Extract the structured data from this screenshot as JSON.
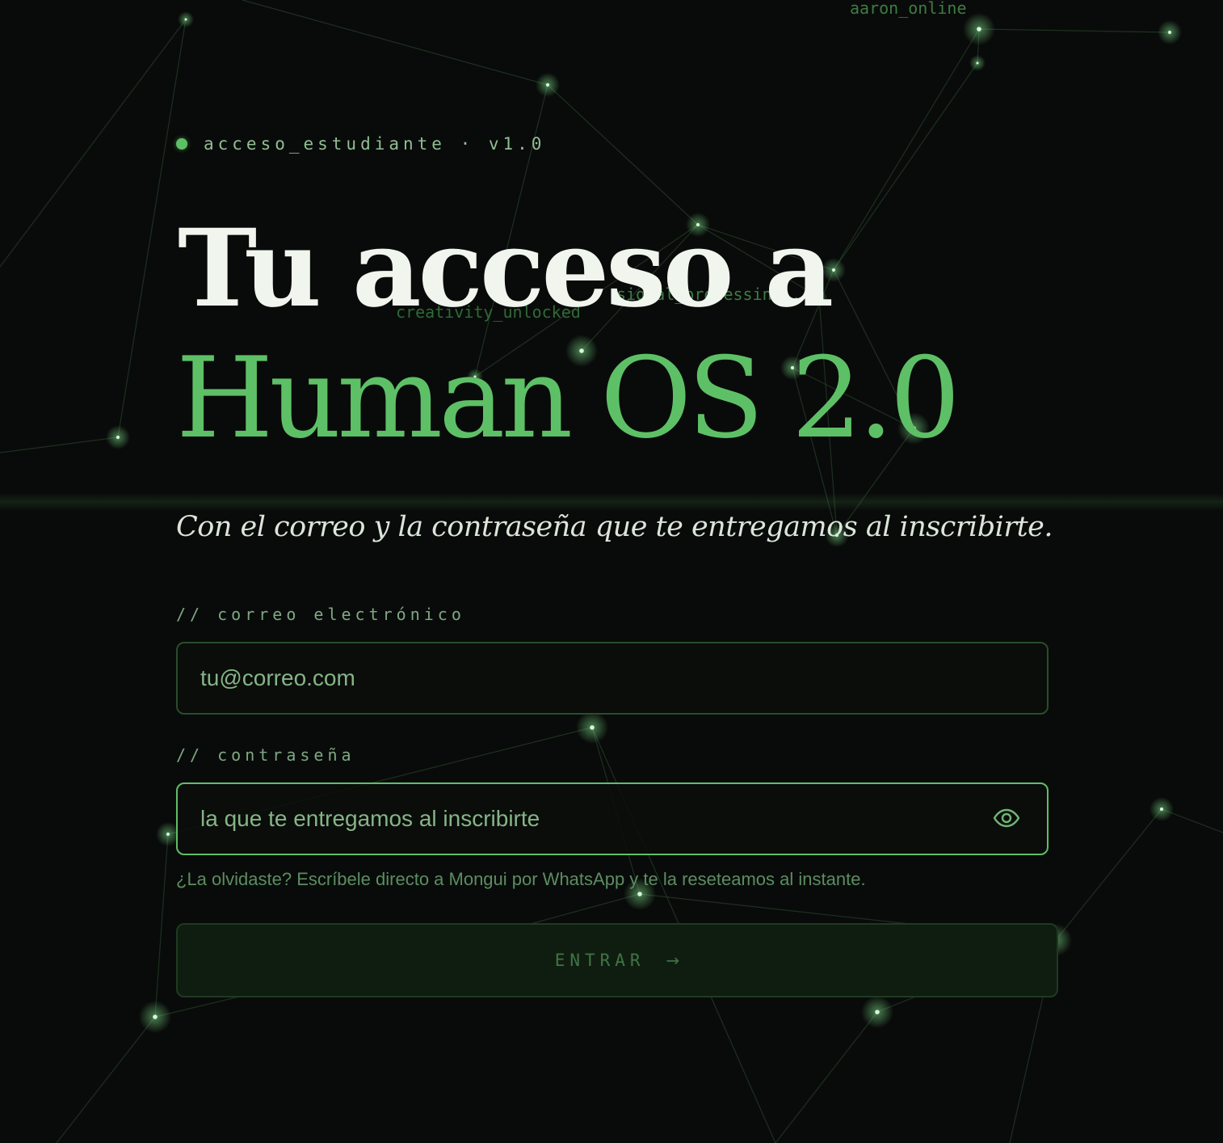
{
  "background": {
    "floating_labels": {
      "aaron": "aaron_online",
      "signal": "signal_processing...",
      "creativity": "creativity_unlocked"
    }
  },
  "header": {
    "eyebrow": "acceso_estudiante · v1.0",
    "title_line1": "Tu acceso a",
    "title_line2": "Human OS 2.0",
    "subtitle": "Con el correo y la contraseña que te entregamos al inscribirte."
  },
  "form": {
    "email_label": "// correo electrónico",
    "email_placeholder": "tu@correo.com",
    "password_label": "// contraseña",
    "password_placeholder": "la que te entregamos al inscribirte",
    "help_text": "¿La olvidaste? Escríbele directo a Mongui por WhatsApp y te la reseteamos al instante.",
    "submit_label": "ENTRAR",
    "submit_arrow": "→"
  },
  "colors": {
    "background": "#090b0a",
    "accent": "#5ec066",
    "focus_border": "#5fbf67",
    "muted_border": "#2a4c2d"
  },
  "icons": {
    "status": "status-dot-icon",
    "password_toggle": "eye-icon",
    "submit": "arrow-right-icon"
  }
}
